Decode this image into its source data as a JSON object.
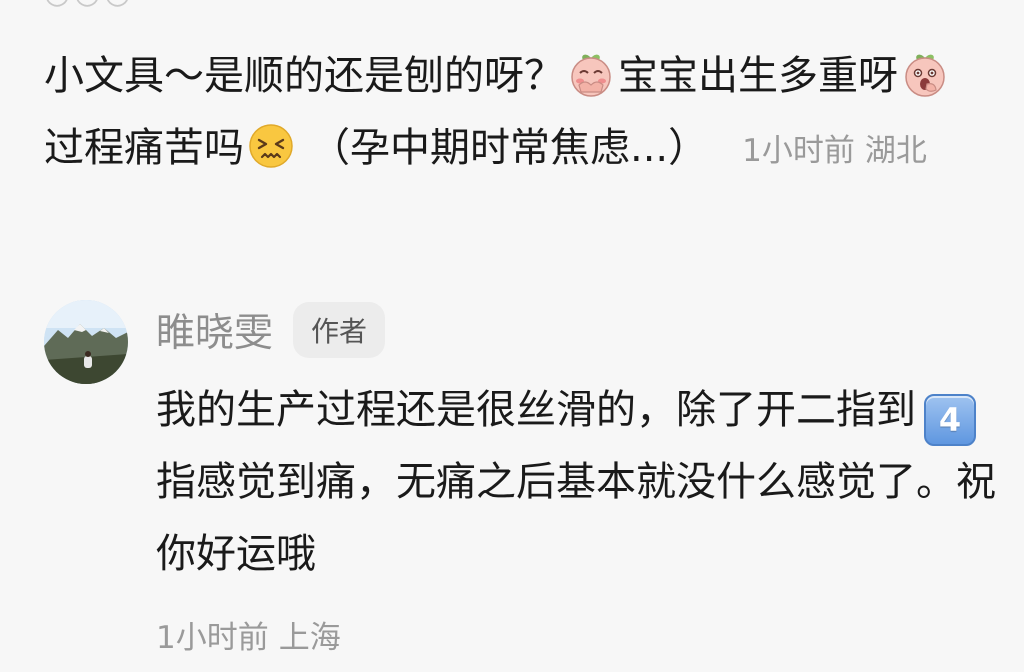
{
  "comment": {
    "segments": [
      "小文具～是顺的还是刨的呀？",
      "宝宝出生多重呀",
      "过程痛苦吗",
      "（孕中期时常焦虑...）"
    ],
    "time": "1小时前",
    "location": "湖北"
  },
  "reply": {
    "author_name": "睢晓雯",
    "author_badge": "作者",
    "body_part1": "我的生产过程还是很丝滑的，除了开二指到",
    "keycap_number": "4",
    "body_part2": "指感觉到痛，无痛之后基本就没什么感觉了。祝你好运哦",
    "time": "1小时前",
    "location": "上海"
  },
  "icons": [
    "peach-covering-mouth-icon",
    "peach-shocked-icon",
    "confounded-face-icon",
    "keycap-4-icon"
  ]
}
